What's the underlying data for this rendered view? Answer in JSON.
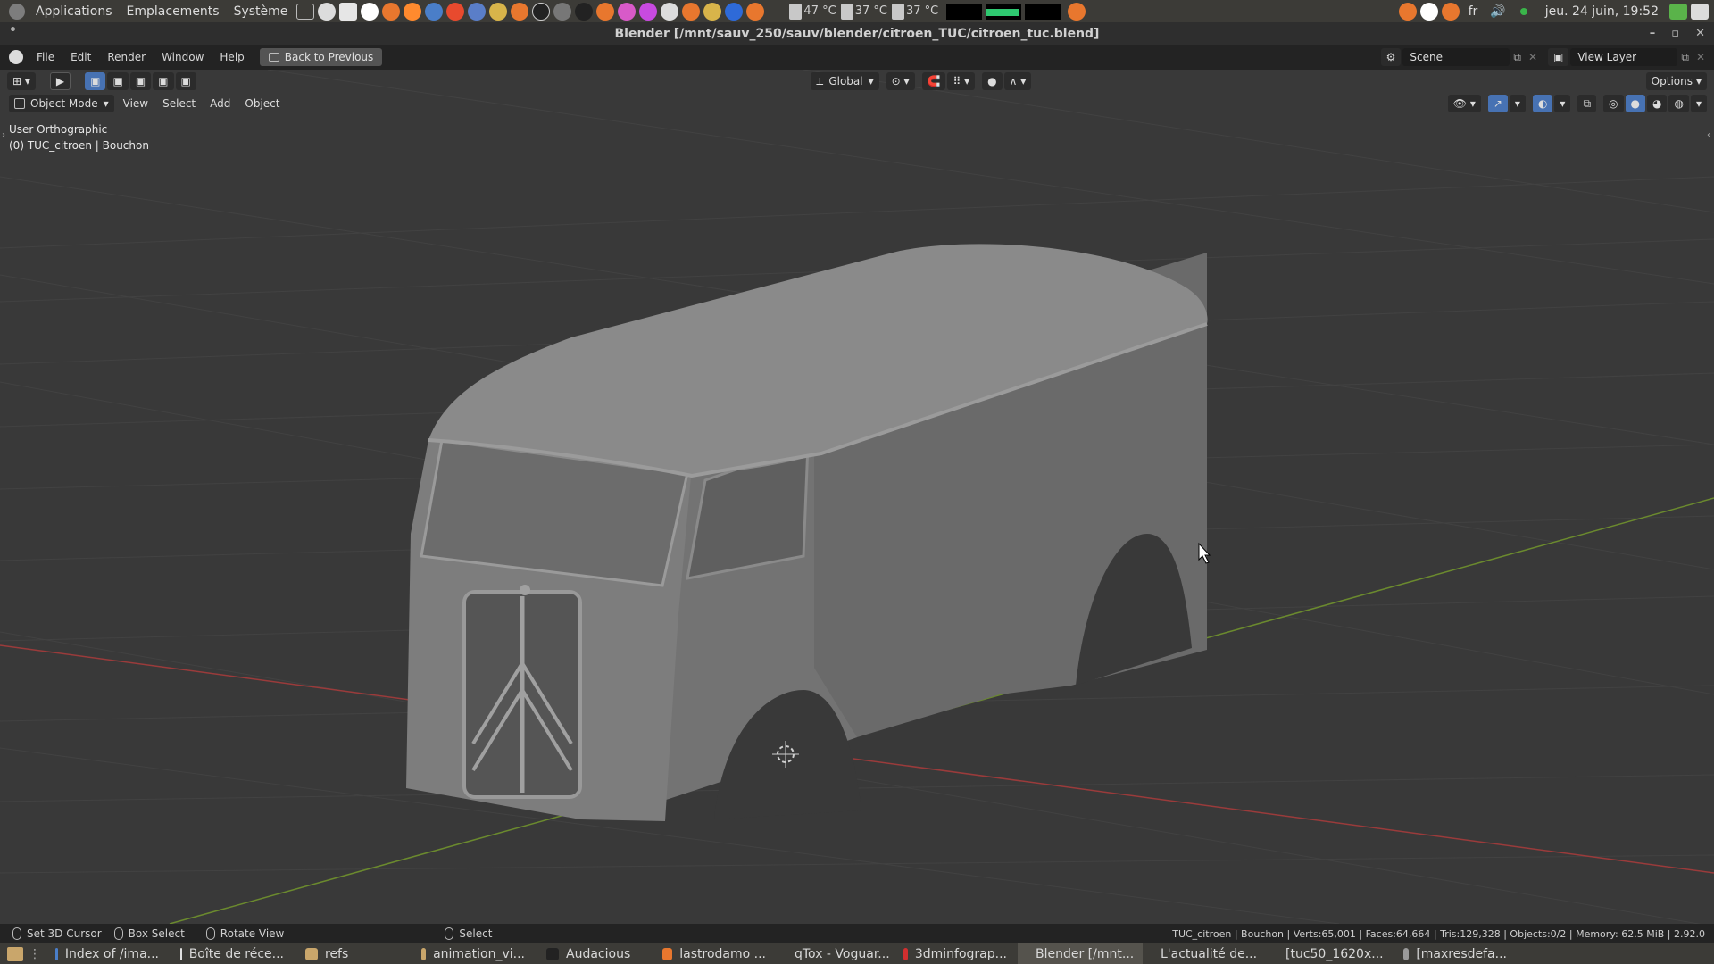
{
  "os_panel": {
    "menus": [
      "Applications",
      "Emplacements",
      "Système"
    ],
    "temps": [
      "47 °C",
      "37 °C",
      "37 °C"
    ],
    "language": "fr",
    "clock": "jeu. 24 juin, 19:52"
  },
  "window": {
    "title": "Blender [/mnt/sauv_250/sauv/blender/citroen_TUC/citroen_tuc.blend]"
  },
  "topbar": {
    "menus": [
      "File",
      "Edit",
      "Render",
      "Window",
      "Help"
    ],
    "back_button": "Back to Previous",
    "scene": "Scene",
    "view_layer": "View Layer"
  },
  "viewport_header": {
    "transform_orientation": "Global",
    "options": "Options",
    "mode": "Object Mode",
    "menus": [
      "View",
      "Select",
      "Add",
      "Object"
    ]
  },
  "viewport": {
    "view_name": "User Orthographic",
    "object_info": "(0) TUC_citroen | Bouchon"
  },
  "statusbar": {
    "items": [
      "Set 3D Cursor",
      "Box Select",
      "Rotate View",
      "Select"
    ],
    "stats": "TUC_citroen | Bouchon | Verts:65,001 | Faces:64,664 | Tris:129,328 | Objects:0/2 | Memory: 62.5 MiB | 2.92.0"
  },
  "taskbar": {
    "tasks": [
      {
        "label": "Index of /ima...",
        "color": "#4a7ec8"
      },
      {
        "label": "Boîte de réce...",
        "color": "#e0e0e0"
      },
      {
        "label": "refs",
        "color": "#c9a66b"
      },
      {
        "label": "animation_vi...",
        "color": "#c9a66b"
      },
      {
        "label": "Audacious",
        "color": "#222222"
      },
      {
        "label": "lastrodamo ...",
        "color": "#e8772e"
      },
      {
        "label": "qTox - Voguar...",
        "color": "#5ab34a"
      },
      {
        "label": "3dminfograp...",
        "color": "#d22f2f"
      },
      {
        "label": "Blender [/mnt...",
        "color": "#e8772e"
      },
      {
        "label": "L'actualité de...",
        "color": "#e86a2e"
      },
      {
        "label": "[tuc50_1620x...",
        "color": "#9a9a9a"
      },
      {
        "label": "[maxresdefa...",
        "color": "#9a9a9a"
      }
    ]
  },
  "colors": {
    "x_axis": "#9a3b3b",
    "y_axis": "#6b8a2e",
    "model": "#8c8c8c",
    "accent": "#e8772e"
  }
}
